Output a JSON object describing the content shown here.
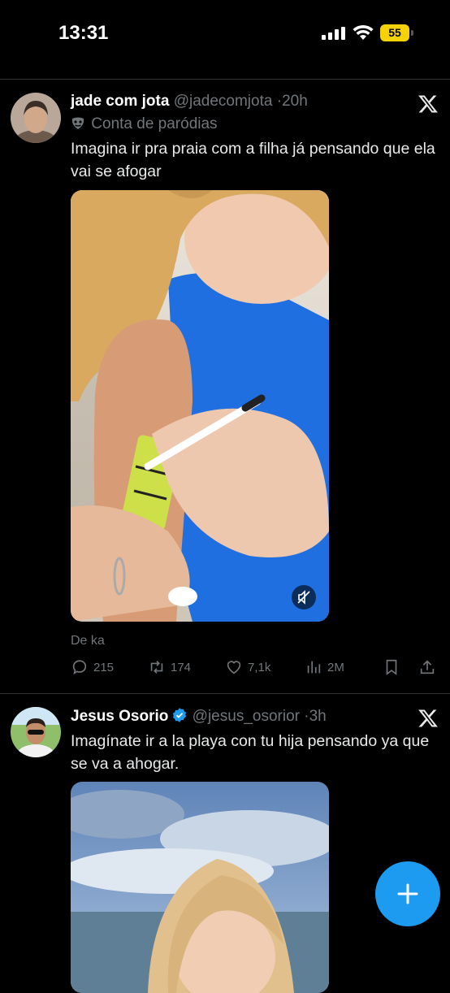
{
  "status_bar": {
    "time": "13:31",
    "battery": "55"
  },
  "tweets": [
    {
      "name": "jade com jota",
      "handle": "@jadecomjota",
      "dot": "·",
      "time": "20h",
      "parody_label": "Conta de paródias",
      "text": "Imagina ir pra praia com a filha já pensando que ela vai se afogar",
      "caption": "De ka",
      "stats": {
        "replies": "215",
        "reposts": "174",
        "likes": "7,1k",
        "views": "2M"
      }
    },
    {
      "name": "Jesus Osorio",
      "handle": "@jesus_osorior",
      "dot": "·",
      "time": "3h",
      "text": "Imagínate ir a la playa con tu hija pensando ya que se va a ahogar."
    }
  ],
  "colors": {
    "accent": "#1d9bf0",
    "muted": "#71767b",
    "battery": "#f5d20a"
  }
}
